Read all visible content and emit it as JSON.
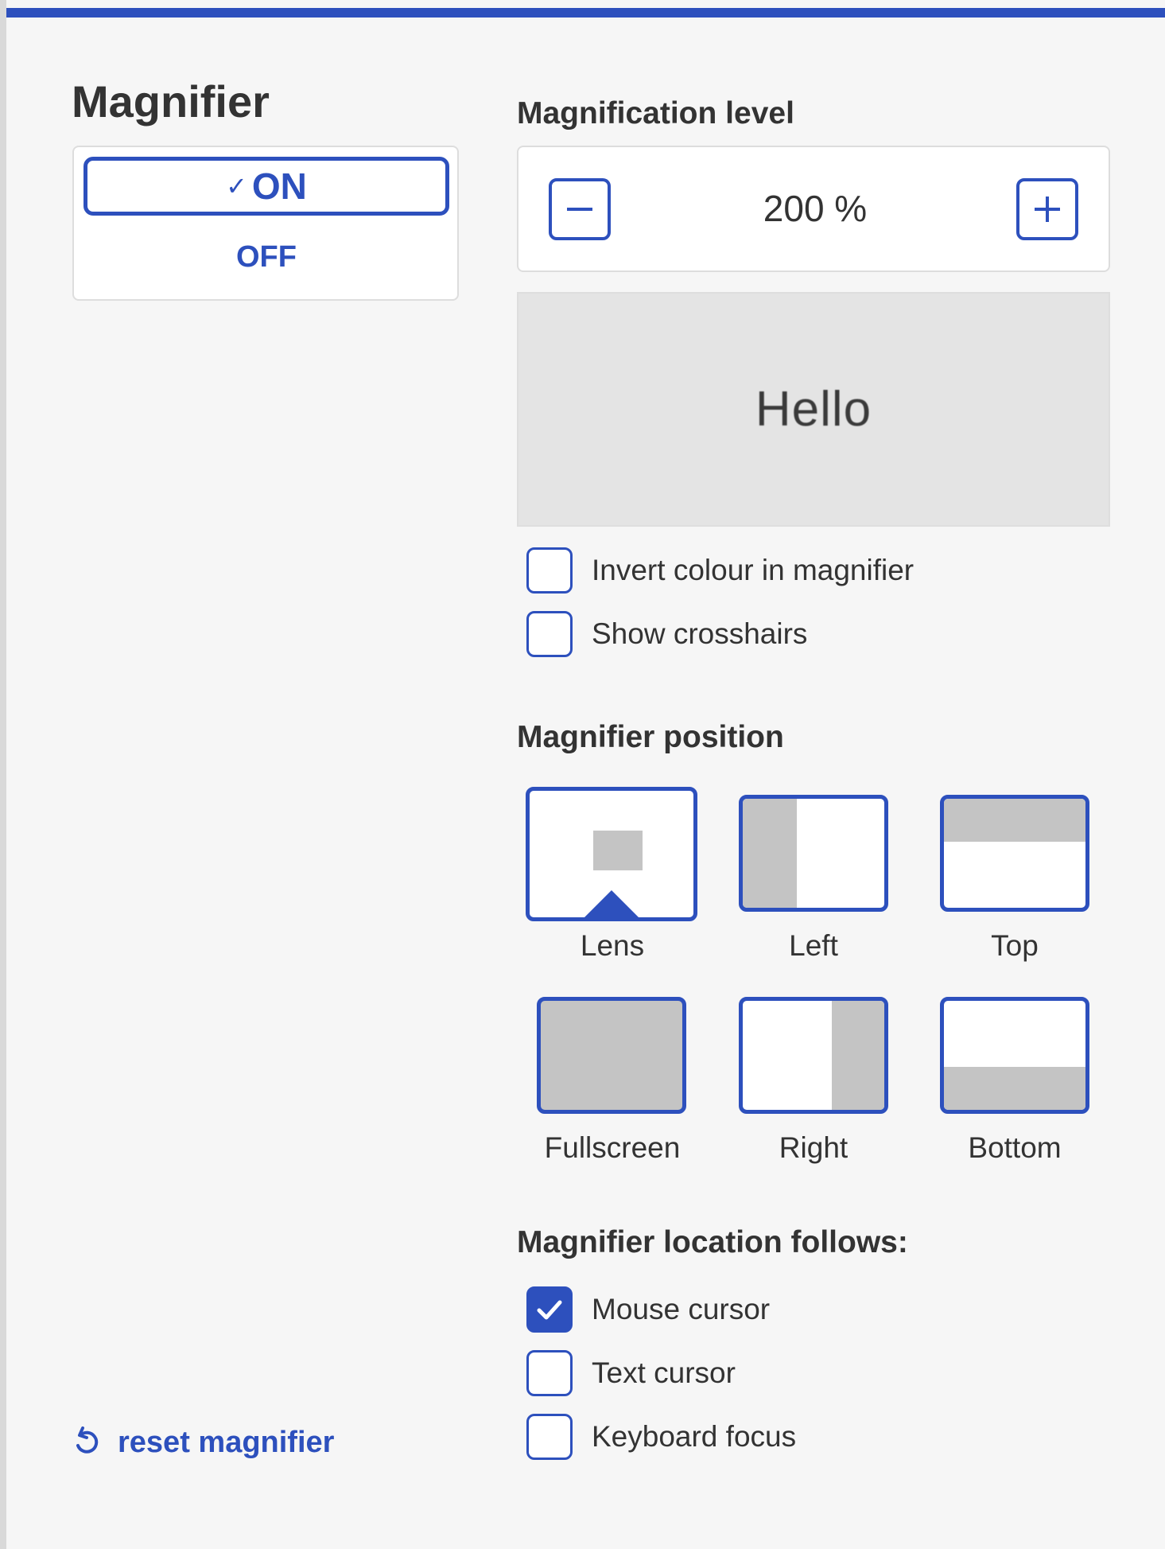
{
  "title": "Magnifier",
  "toggle": {
    "on_label": "ON",
    "off_label": "OFF",
    "selected": "ON"
  },
  "magnification": {
    "heading": "Magnification level",
    "value_text": "200 %",
    "minus_icon": "minus-icon",
    "plus_icon": "plus-icon"
  },
  "preview": {
    "text": "Hello"
  },
  "options": [
    {
      "label": "Invert colour in magnifier",
      "checked": false
    },
    {
      "label": "Show crosshairs",
      "checked": false
    }
  ],
  "position": {
    "heading": "Magnifier position",
    "items": [
      {
        "label": "Lens",
        "selected": true
      },
      {
        "label": "Left",
        "selected": false
      },
      {
        "label": "Top",
        "selected": false
      },
      {
        "label": "Fullscreen",
        "selected": false
      },
      {
        "label": "Right",
        "selected": false
      },
      {
        "label": "Bottom",
        "selected": false
      }
    ]
  },
  "follows": {
    "heading": "Magnifier location follows:",
    "items": [
      {
        "label": "Mouse cursor",
        "checked": true
      },
      {
        "label": "Text cursor",
        "checked": false
      },
      {
        "label": "Keyboard focus",
        "checked": false
      }
    ]
  },
  "reset": {
    "label": "reset magnifier",
    "icon": "reset-icon"
  },
  "colors": {
    "accent": "#2d50bd",
    "background": "#f6f6f6",
    "text": "#333333",
    "tile_fill": "#c4c4c4"
  }
}
